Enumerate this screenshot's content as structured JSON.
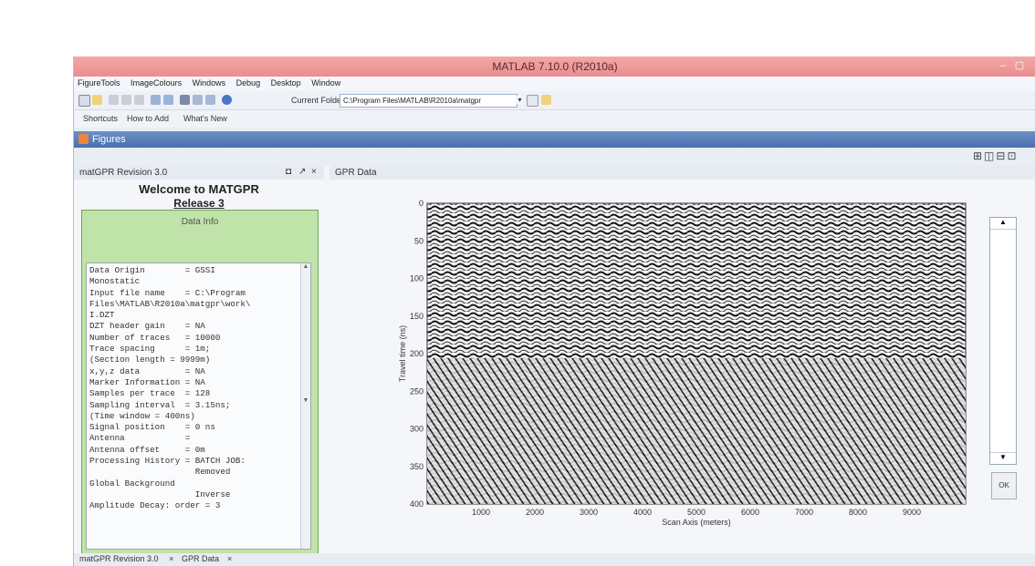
{
  "window": {
    "title": "MATLAB 7.10.0 (R2010a)"
  },
  "menu": [
    "FigureTools",
    "ImageColours",
    "Windows",
    "Debug",
    "Desktop",
    "Window"
  ],
  "toolbar": {
    "current_folder_label": "Current Folder:",
    "current_folder": "C:\\Program Files\\MATLAB\\R2010a\\matgpr"
  },
  "shortcuts": {
    "label": "Shortcuts",
    "how_to_add": "How to Add",
    "whats_new": "What's New"
  },
  "figures": {
    "title": "Figures"
  },
  "left_panel": {
    "title": "matGPR Revision 3.0",
    "welcome": "Welcome to MATGPR",
    "release": "Release 3",
    "box_title": "Data Info",
    "lines": [
      "Data Origin        = GSSI",
      "Monostatic",
      "Input file name    = C:\\Program",
      "Files\\MATLAB\\R2010a\\matgpr\\work\\",
      "I.DZT",
      "DZT header gain    = NA",
      "Number of traces   = 10000",
      "Trace spacing      = 1m;",
      "(Section length = 9999m)",
      "x,y,z data         = NA",
      "Marker Information = NA",
      "Samples per trace  = 128",
      "Sampling interval  = 3.15ns;",
      "(Time window = 400ns)",
      "Signal position    = 0 ns",
      "Antenna            =",
      "Antenna offset     = 0m",
      "Processing History = BATCH JOB:",
      "                     Removed",
      "Global Background",
      "                     Inverse",
      "Amplitude Decay: order = 3"
    ]
  },
  "right_panel": {
    "title": "GPR Data",
    "ok_label": "OK"
  },
  "chart_data": {
    "type": "heatmap",
    "title": "",
    "xlabel": "Scan Axis (meters)",
    "ylabel": "Travel time (ns)",
    "x_ticks": [
      1000,
      2000,
      3000,
      4000,
      5000,
      6000,
      7000,
      8000,
      9000
    ],
    "y_ticks": [
      0,
      50,
      100,
      150,
      200,
      250,
      300,
      350,
      400
    ],
    "xlim": [
      0,
      10000
    ],
    "ylim": [
      0,
      400
    ],
    "y_reversed": true,
    "colormap": "gray"
  },
  "bottom_tabs": [
    "matGPR Revision 3.0",
    "GPR Data"
  ]
}
